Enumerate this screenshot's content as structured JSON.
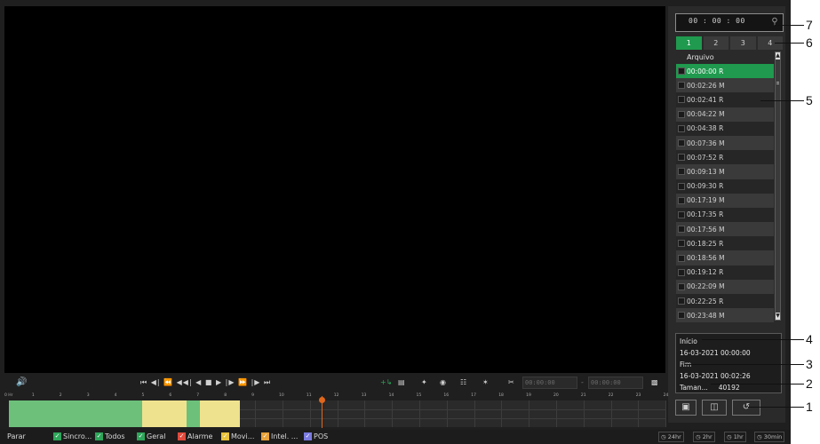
{
  "time_search": {
    "value": "00 : 00 : 00"
  },
  "tabs": [
    "1",
    "2",
    "3",
    "4"
  ],
  "file_list": {
    "header": "Arquivo",
    "rows": [
      {
        "label": "00:00:00  R",
        "selected": true
      },
      {
        "label": "00:02:26  M"
      },
      {
        "label": "00:02:41  R"
      },
      {
        "label": "00:04:22  M"
      },
      {
        "label": "00:04:38  R"
      },
      {
        "label": "00:07:36  M"
      },
      {
        "label": "00:07:52  R"
      },
      {
        "label": "00:09:13  M"
      },
      {
        "label": "00:09:30  R"
      },
      {
        "label": "00:17:19  M"
      },
      {
        "label": "00:17:35  R"
      },
      {
        "label": "00:17:56  M"
      },
      {
        "label": "00:18:25  R"
      },
      {
        "label": "00:18:56  M"
      },
      {
        "label": "00:19:12  R"
      },
      {
        "label": "00:22:09  M"
      },
      {
        "label": "00:22:25  R"
      },
      {
        "label": "00:23:48  M"
      }
    ]
  },
  "info": {
    "start_label": "Início",
    "start_value": "16-03-2021 00:00:00",
    "end_label": "Fim",
    "end_value": "16-03-2021 00:02:26",
    "size_label": "Taman...",
    "size_value": "40192"
  },
  "callouts": [
    "7",
    "6",
    "5",
    "4",
    "3",
    "2",
    "1"
  ],
  "time_from": "00:00:00",
  "time_to": "00:00:00",
  "ruler": [
    "0 Hr",
    "1",
    "2",
    "3",
    "4",
    "5",
    "6",
    "7",
    "8",
    "9",
    "10",
    "11",
    "12",
    "13",
    "14",
    "15",
    "16",
    "17",
    "18",
    "19",
    "20",
    "21",
    "22",
    "23",
    "24"
  ],
  "legend": {
    "stop": "Parar",
    "items": [
      {
        "label": "Sincro...",
        "color": "#2ea55a"
      },
      {
        "label": "Todos",
        "color": "#2ea55a"
      },
      {
        "label": "Geral",
        "color": "#2ea55a"
      },
      {
        "label": "Alarme",
        "color": "#e04a3c"
      },
      {
        "label": "Movi...",
        "color": "#e8c23a"
      },
      {
        "label": "Intel. ...",
        "color": "#e8a33a"
      },
      {
        "label": "POS",
        "color": "#7a7ae0"
      }
    ]
  },
  "zoom": [
    "24hr",
    "2hr",
    "1hr",
    "30min"
  ],
  "colors": {
    "accent": "#1f9a4e",
    "timeline_green": "#6cc07a",
    "timeline_yellow": "#efe28e",
    "cursor": "#e0671c"
  }
}
